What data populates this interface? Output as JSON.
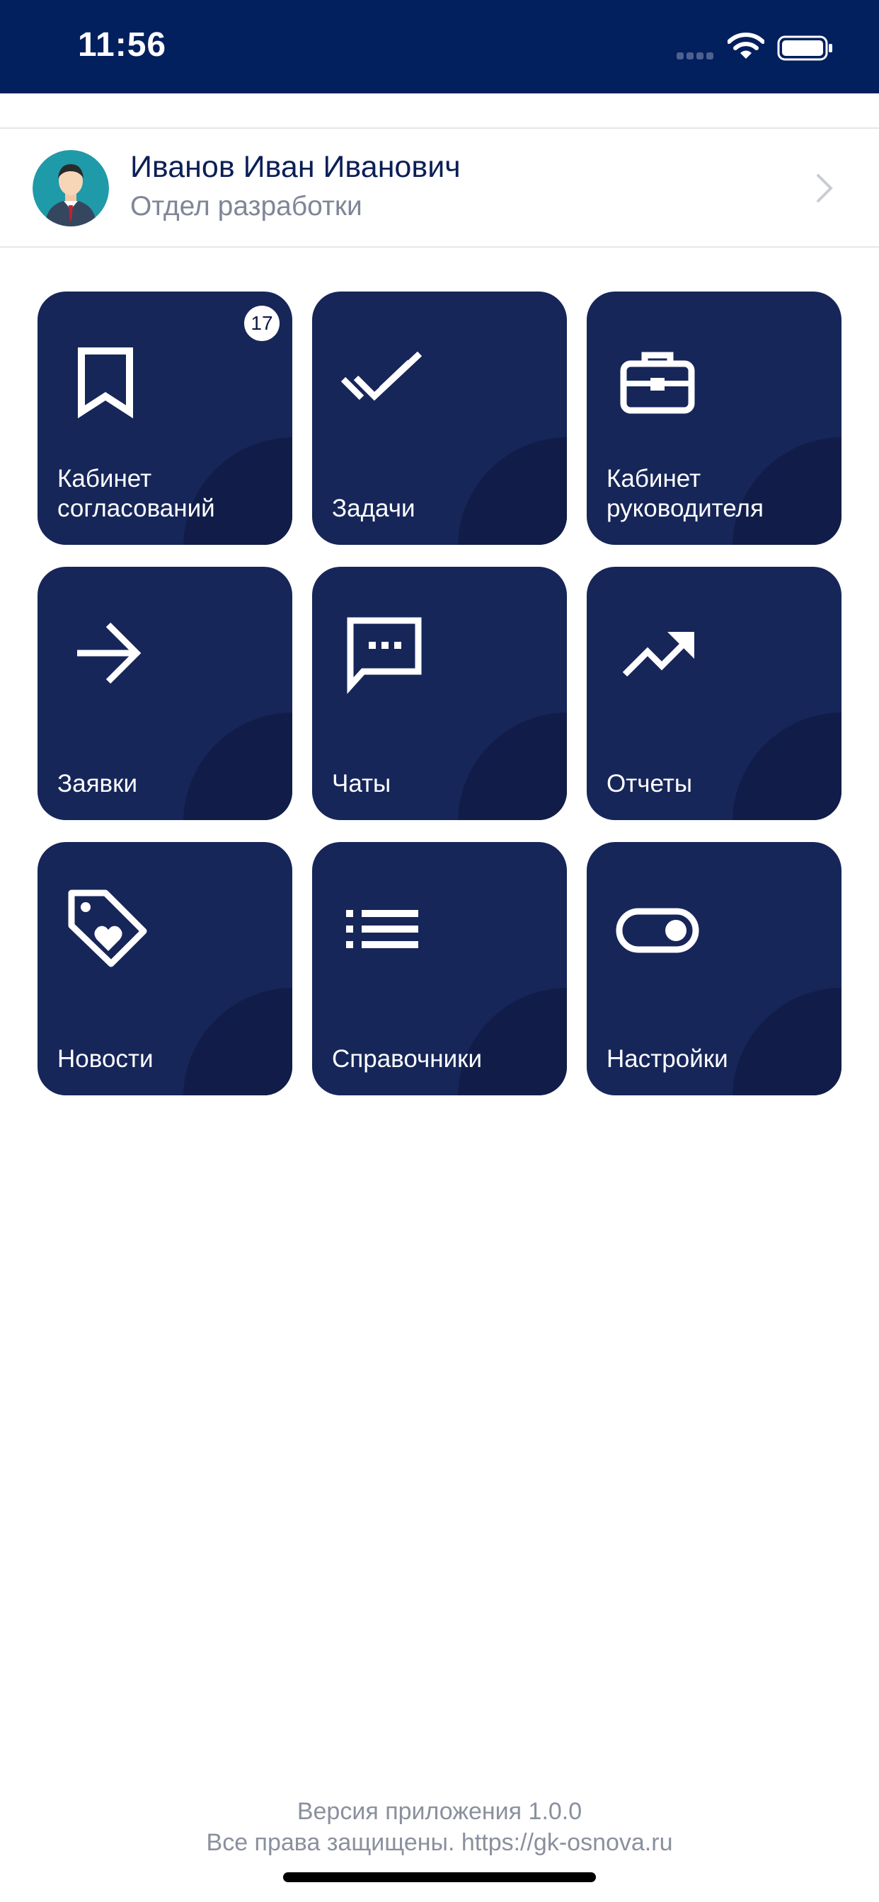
{
  "status_bar": {
    "time": "11:56"
  },
  "profile": {
    "name": "Иванов Иван Иванович",
    "department": "Отдел разработки"
  },
  "tiles": [
    {
      "label": "Кабинет\nсогласований",
      "icon": "bookmark-icon",
      "badge": "17"
    },
    {
      "label": "Задачи",
      "icon": "double-check-icon"
    },
    {
      "label": "Кабинет\nруководителя",
      "icon": "briefcase-icon"
    },
    {
      "label": "Заявки",
      "icon": "arrow-right-icon"
    },
    {
      "label": "Чаты",
      "icon": "chat-icon"
    },
    {
      "label": "Отчеты",
      "icon": "trending-up-icon"
    },
    {
      "label": "Новости",
      "icon": "tag-heart-icon"
    },
    {
      "label": "Справочники",
      "icon": "list-icon"
    },
    {
      "label": "Настройки",
      "icon": "toggle-icon"
    }
  ],
  "footer": {
    "version": "Версия приложения 1.0.0",
    "rights": "Все права защищены. https://gk-osnova.ru"
  },
  "colors": {
    "status_bar": "#021f5e",
    "tile": "#172659",
    "tile_shape": "#111d48",
    "name_text": "#0b1f57",
    "muted_text": "#7f8697"
  }
}
